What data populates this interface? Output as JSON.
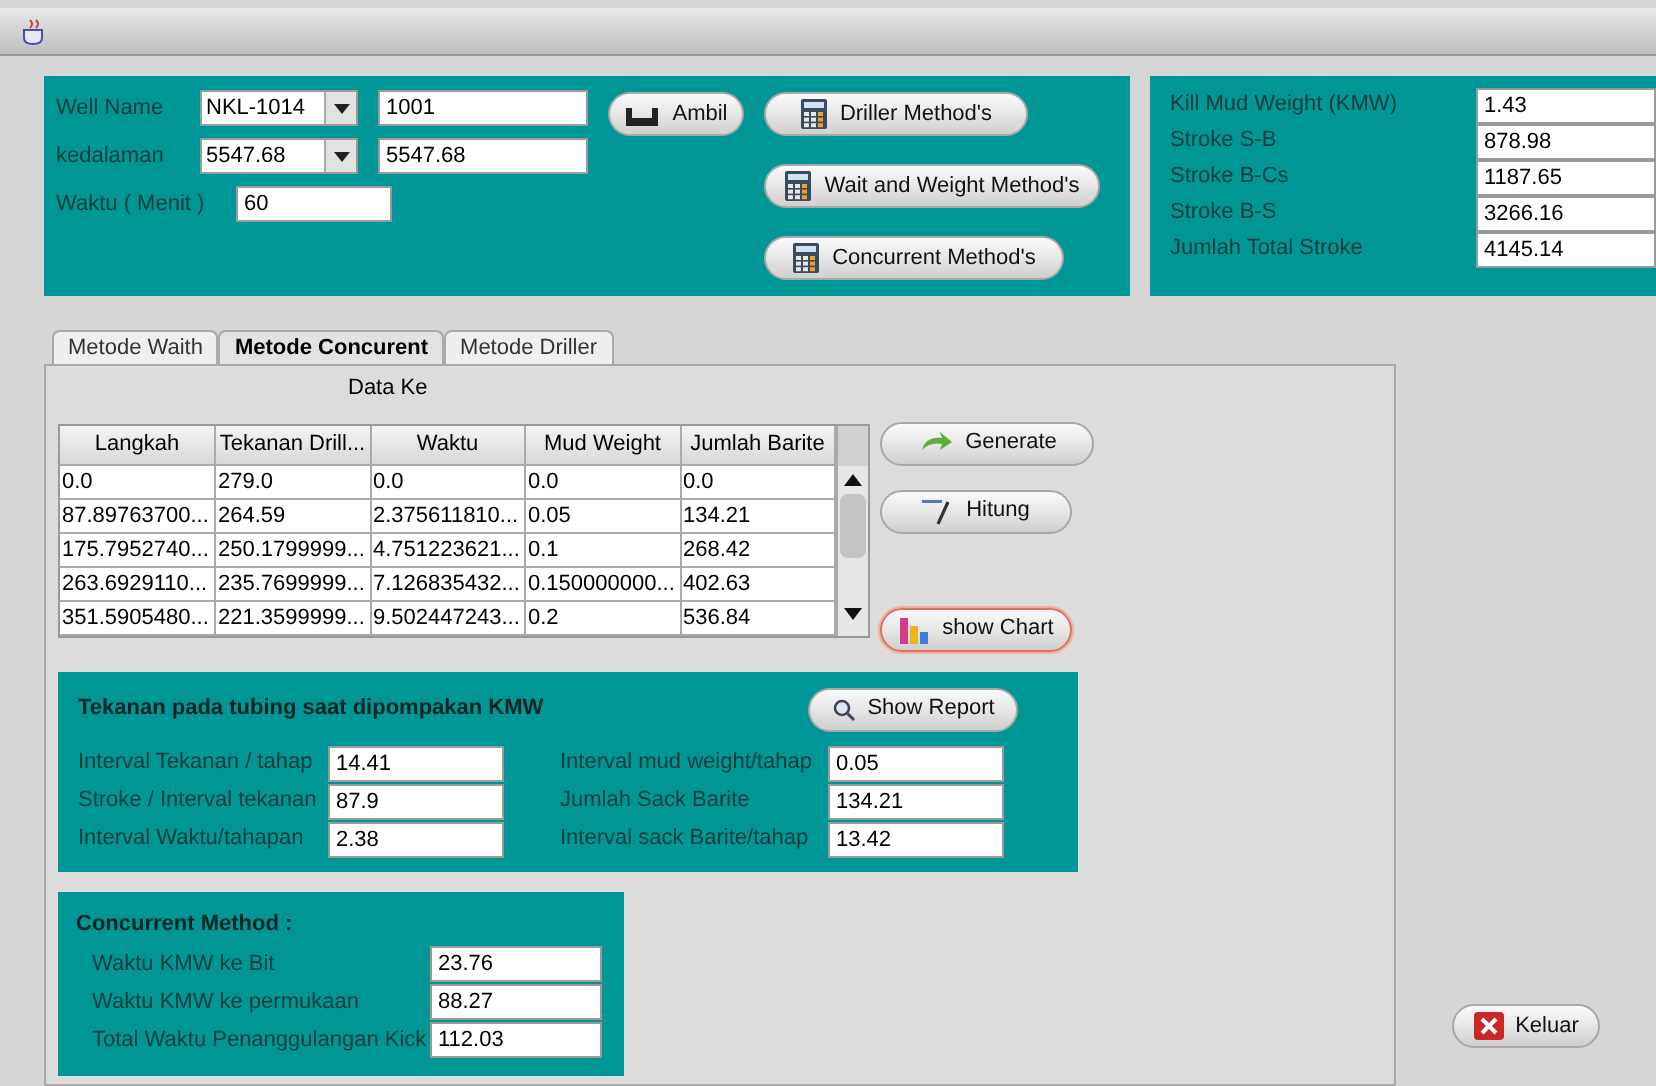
{
  "well": {
    "rows": [
      {
        "label": "Well Name",
        "combo": "NKL-1014",
        "value": "1001"
      },
      {
        "label": "kedalaman",
        "combo": "5547.68",
        "value": "5547.68"
      },
      {
        "label": "Waktu ( Menit )",
        "value": "60"
      }
    ],
    "fetch_button": "Ambil",
    "method_buttons": [
      "Driller Method's",
      "Wait and Weight Method's",
      "Concurrent Method's"
    ]
  },
  "results": [
    {
      "label": "Kill Mud Weight (KMW)",
      "value": "1.43"
    },
    {
      "label": "Stroke S-B",
      "value": "878.98"
    },
    {
      "label": "Stroke B-Cs",
      "value": "1187.65"
    },
    {
      "label": "Stroke B-S",
      "value": "3266.16"
    },
    {
      "label": "Jumlah Total Stroke",
      "value": "4145.14"
    }
  ],
  "tabs": [
    {
      "label": "Metode Waith",
      "selected": false
    },
    {
      "label": "Metode Concurent",
      "selected": true
    },
    {
      "label": "Metode Driller",
      "selected": false
    }
  ],
  "data_label": "Data Ke",
  "table": {
    "columns": [
      "Langkah",
      "Tekanan Drill...",
      "Waktu",
      "Mud Weight",
      "Jumlah Barite"
    ],
    "rows": [
      [
        "0.0",
        "279.0",
        "0.0",
        "0.0",
        "0.0"
      ],
      [
        "87.89763700...",
        "264.59",
        "2.375611810...",
        "0.05",
        "134.21"
      ],
      [
        "175.7952740...",
        "250.1799999...",
        "4.751223621...",
        "0.1",
        "268.42"
      ],
      [
        "263.6929110...",
        "235.7699999...",
        "7.126835432...",
        "0.150000000...",
        "402.63"
      ],
      [
        "351.5905480...",
        "221.3599999...",
        "9.502447243...",
        "0.2",
        "536.84"
      ]
    ]
  },
  "side_buttons": [
    {
      "label": "Generate",
      "kind": "generate",
      "focused": false
    },
    {
      "label": "Hitung",
      "kind": "calculate",
      "focused": false
    },
    {
      "label": "show Chart",
      "kind": "chart",
      "focused": true
    }
  ],
  "tubing": {
    "title": "Tekanan pada tubing saat dipompakan KMW",
    "report_button": "Show Report",
    "left": [
      {
        "label": "Interval Tekanan / tahap",
        "value": "14.41"
      },
      {
        "label": "Stroke / Interval tekanan",
        "value": "87.9"
      },
      {
        "label": "Interval Waktu/tahapan",
        "value": "2.38"
      }
    ],
    "right": [
      {
        "label": "Interval mud weight/tahap",
        "value": "0.05"
      },
      {
        "label": "Jumlah Sack Barite",
        "value": "134.21"
      },
      {
        "label": "Interval sack Barite/tahap",
        "value": "13.42"
      }
    ]
  },
  "concurrent": {
    "title": "Concurrent Method :",
    "fields": [
      {
        "label": "Waktu KMW ke Bit",
        "value": "23.76"
      },
      {
        "label": "Waktu KMW ke permukaan",
        "value": "88.27"
      },
      {
        "label": "Total Waktu Penanggulangan Kick",
        "value": "112.03"
      }
    ]
  },
  "exit_button": "Keluar"
}
